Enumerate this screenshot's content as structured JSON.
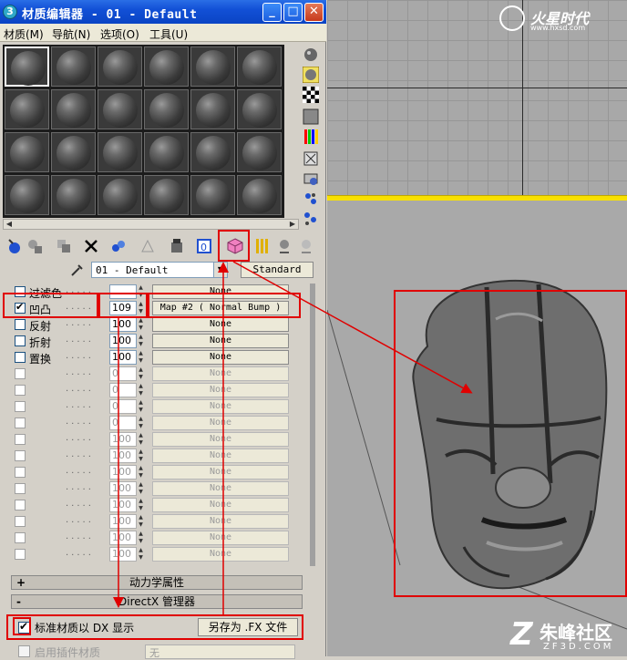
{
  "window": {
    "title": "材质编辑器 - 01 - Default",
    "app_icon": "3",
    "controls": {
      "minimize": "_",
      "maximize": "□",
      "close": "✕"
    }
  },
  "menu": [
    "材质(M)",
    "导航(N)",
    "选项(O)",
    "工具(U)"
  ],
  "material": {
    "name": "01 - Default",
    "type_button": "Standard"
  },
  "maps": [
    {
      "label": "过滤色",
      "amount": "",
      "map": "None",
      "checked": false,
      "enabled": true
    },
    {
      "label": "凹凸",
      "amount": "109",
      "map": "Map #2  ( Normal Bump )",
      "checked": true,
      "enabled": true
    },
    {
      "label": "反射",
      "amount": "100",
      "map": "None",
      "checked": false,
      "enabled": true
    },
    {
      "label": "折射",
      "amount": "100",
      "map": "None",
      "checked": false,
      "enabled": true
    },
    {
      "label": "置换",
      "amount": "100",
      "map": "None",
      "checked": false,
      "enabled": true
    },
    {
      "label": "",
      "amount": "0",
      "map": "None",
      "checked": false,
      "enabled": false
    },
    {
      "label": "",
      "amount": "0",
      "map": "None",
      "checked": false,
      "enabled": false
    },
    {
      "label": "",
      "amount": "0",
      "map": "None",
      "checked": false,
      "enabled": false
    },
    {
      "label": "",
      "amount": "0",
      "map": "None",
      "checked": false,
      "enabled": false
    },
    {
      "label": "",
      "amount": "100",
      "map": "None",
      "checked": false,
      "enabled": false
    },
    {
      "label": "",
      "amount": "100",
      "map": "None",
      "checked": false,
      "enabled": false
    },
    {
      "label": "",
      "amount": "100",
      "map": "None",
      "checked": false,
      "enabled": false
    },
    {
      "label": "",
      "amount": "100",
      "map": "None",
      "checked": false,
      "enabled": false
    },
    {
      "label": "",
      "amount": "100",
      "map": "None",
      "checked": false,
      "enabled": false
    },
    {
      "label": "",
      "amount": "100",
      "map": "None",
      "checked": false,
      "enabled": false
    },
    {
      "label": "",
      "amount": "100",
      "map": "None",
      "checked": false,
      "enabled": false
    },
    {
      "label": "",
      "amount": "100",
      "map": "None",
      "checked": false,
      "enabled": false
    }
  ],
  "rollouts": {
    "dynamics": {
      "sign": "+",
      "label": "动力学属性"
    },
    "directx": {
      "sign": "-",
      "label": "DirectX 管理器"
    }
  },
  "directx": {
    "display_label": "标准材质以 DX 显示",
    "save_fx_button": "另存为 .FX 文件",
    "plugin_label": "启用插件材质",
    "plugin_value": "无"
  },
  "logo": {
    "text": "火星时代",
    "url": "www.hxsd.com"
  },
  "watermark": {
    "glyph": "Z",
    "cn": "朱峰社区",
    "en": "ZF3D.COM"
  },
  "colors": {
    "highlight": "#e00000",
    "title_bar": "#0a44c4",
    "viewport_accent": "#f8e000"
  }
}
